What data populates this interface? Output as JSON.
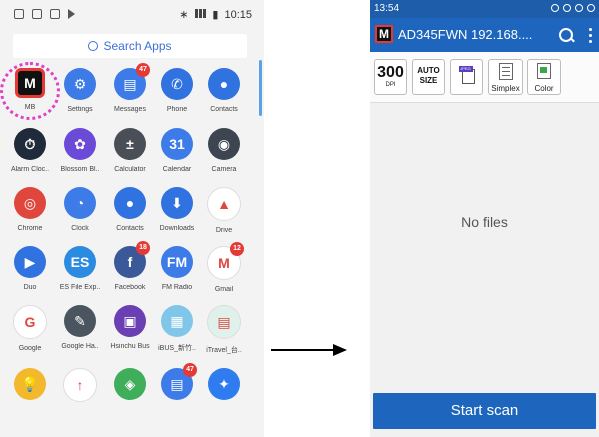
{
  "left_phone": {
    "status_time": "10:15",
    "search_placeholder": "Search Apps",
    "rows": [
      [
        {
          "label": "MB",
          "icon": "mb-app-icon",
          "color": "#111111",
          "text": "M",
          "badge": ""
        },
        {
          "label": "Settings",
          "icon": "gear-icon",
          "color": "#3d7be8",
          "text": "⚙",
          "badge": ""
        },
        {
          "label": "Messages",
          "icon": "message-icon",
          "color": "#3d7be8",
          "text": "▤",
          "badge": "47"
        },
        {
          "label": "Phone",
          "icon": "phone-icon",
          "color": "#2f72e0",
          "text": "✆",
          "badge": ""
        },
        {
          "label": "Contacts",
          "icon": "contacts-icon",
          "color": "#2f72e0",
          "text": "●",
          "badge": ""
        }
      ],
      [
        {
          "label": "Alarm Cloc..",
          "icon": "alarm-clock-icon",
          "color": "#1f2a3a",
          "text": "⏱",
          "badge": ""
        },
        {
          "label": "Blossom Bl..",
          "icon": "blossom-game-icon",
          "color": "#6a4ad6",
          "text": "✿",
          "badge": ""
        },
        {
          "label": "Calculator",
          "icon": "calculator-icon",
          "color": "#4a4f57",
          "text": "±",
          "badge": ""
        },
        {
          "label": "Calendar",
          "icon": "calendar-icon",
          "color": "#3d7be8",
          "text": "31",
          "badge": ""
        },
        {
          "label": "Camera",
          "icon": "camera-icon",
          "color": "#3d4650",
          "text": "◉",
          "badge": ""
        }
      ],
      [
        {
          "label": "Chrome",
          "icon": "chrome-icon",
          "color": "#e0473c",
          "text": "◎",
          "badge": ""
        },
        {
          "label": "Clock",
          "icon": "clock-icon",
          "color": "#3d7be8",
          "text": "◔",
          "badge": ""
        },
        {
          "label": "Contacts",
          "icon": "contacts-icon",
          "color": "#2f72e0",
          "text": "●",
          "badge": ""
        },
        {
          "label": "Downloads",
          "icon": "downloads-icon",
          "color": "#2f72e0",
          "text": "⬇",
          "badge": ""
        },
        {
          "label": "Drive",
          "icon": "drive-icon",
          "color": "#ffffff",
          "text": "▲",
          "badge": ""
        }
      ],
      [
        {
          "label": "Duo",
          "icon": "duo-icon",
          "color": "#2f72e0",
          "text": "▶",
          "badge": ""
        },
        {
          "label": "ES File Exp..",
          "icon": "es-file-explorer-icon",
          "color": "#2b8be0",
          "text": "ES",
          "badge": ""
        },
        {
          "label": "Facebook",
          "icon": "facebook-icon",
          "color": "#3b5998",
          "text": "f",
          "badge": "18"
        },
        {
          "label": "FM Radio",
          "icon": "fm-radio-icon",
          "color": "#3d7be8",
          "text": "FM",
          "badge": ""
        },
        {
          "label": "Gmail",
          "icon": "gmail-icon",
          "color": "#ffffff",
          "text": "M",
          "badge": "12"
        }
      ],
      [
        {
          "label": "Google",
          "icon": "google-icon",
          "color": "#ffffff",
          "text": "G",
          "badge": ""
        },
        {
          "label": "Google Ha..",
          "icon": "google-handwriting-icon",
          "color": "#4a5560",
          "text": "✎",
          "badge": ""
        },
        {
          "label": "Hsinchu Bus",
          "icon": "bus-icon",
          "color": "#6a3fb3",
          "text": "▣",
          "badge": ""
        },
        {
          "label": "iBUS_新竹..",
          "icon": "ibus-icon",
          "color": "#7fc6e8",
          "text": "▦",
          "badge": ""
        },
        {
          "label": "iTravel_台..",
          "icon": "itravel-icon",
          "color": "#dff1ea",
          "text": "▤",
          "badge": ""
        }
      ],
      [
        {
          "label": "",
          "icon": "lightbulb-icon",
          "color": "#f2b92c",
          "text": "💡",
          "badge": ""
        },
        {
          "label": "",
          "icon": "upload-icon",
          "color": "#ffffff",
          "text": "↑",
          "badge": ""
        },
        {
          "label": "",
          "icon": "maps-icon",
          "color": "#3fae5a",
          "text": "◈",
          "badge": ""
        },
        {
          "label": "",
          "icon": "messages-icon",
          "color": "#3d7be8",
          "text": "▤",
          "badge": "47"
        },
        {
          "label": "",
          "icon": "messenger-icon",
          "color": "#2f7bf0",
          "text": "✦",
          "badge": ""
        }
      ]
    ]
  },
  "right_phone": {
    "status_time": "13:54",
    "app_title": "AD345FWN 192.168....",
    "toolbar": {
      "dpi_value": "300",
      "dpi_label": "DPI",
      "size_line1": "AUTO",
      "size_line2": "SIZE",
      "format_tag": "JPEG",
      "simplex_label": "Simplex",
      "color_label": "Color"
    },
    "empty_text": "No files",
    "start_button": "Start scan"
  }
}
